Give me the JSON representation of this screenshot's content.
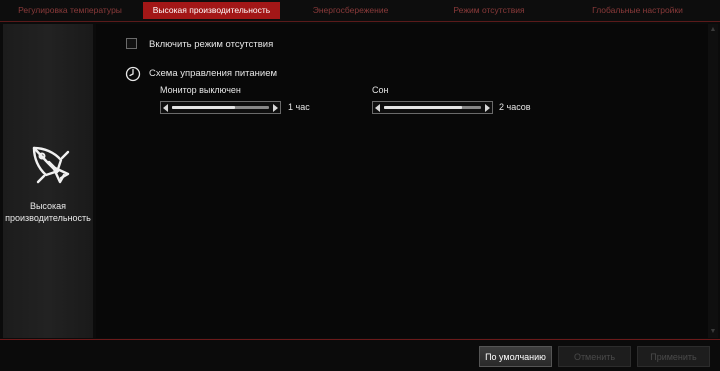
{
  "tabs": [
    {
      "label": "Регулировка температуры",
      "active": false
    },
    {
      "label": "Высокая производительность",
      "active": true
    },
    {
      "label": "Энергосбережение",
      "active": false
    },
    {
      "label": "Режим отсутствия",
      "active": false
    },
    {
      "label": "Глобальные настройки",
      "active": false
    }
  ],
  "side_panel": {
    "icon": "rocket-icon",
    "label_line1": "Высокая",
    "label_line2": "производительность"
  },
  "content": {
    "away_checkbox_label": "Включить режим отсутствия",
    "away_checkbox_checked": false,
    "power_scheme_label": "Схема управления питанием",
    "power_scheme_icon": "clock-icon",
    "monitor_off": {
      "label": "Монитор выключен",
      "value": "1 час",
      "level": 0.65
    },
    "sleep": {
      "label": "Сон",
      "value": "2 часов",
      "level": 0.8
    }
  },
  "buttons": {
    "default_label": "По умолчанию",
    "cancel_label": "Отменить",
    "apply_label": "Применить"
  },
  "colors": {
    "accent": "#a31717",
    "background": "#0b0b0b"
  }
}
